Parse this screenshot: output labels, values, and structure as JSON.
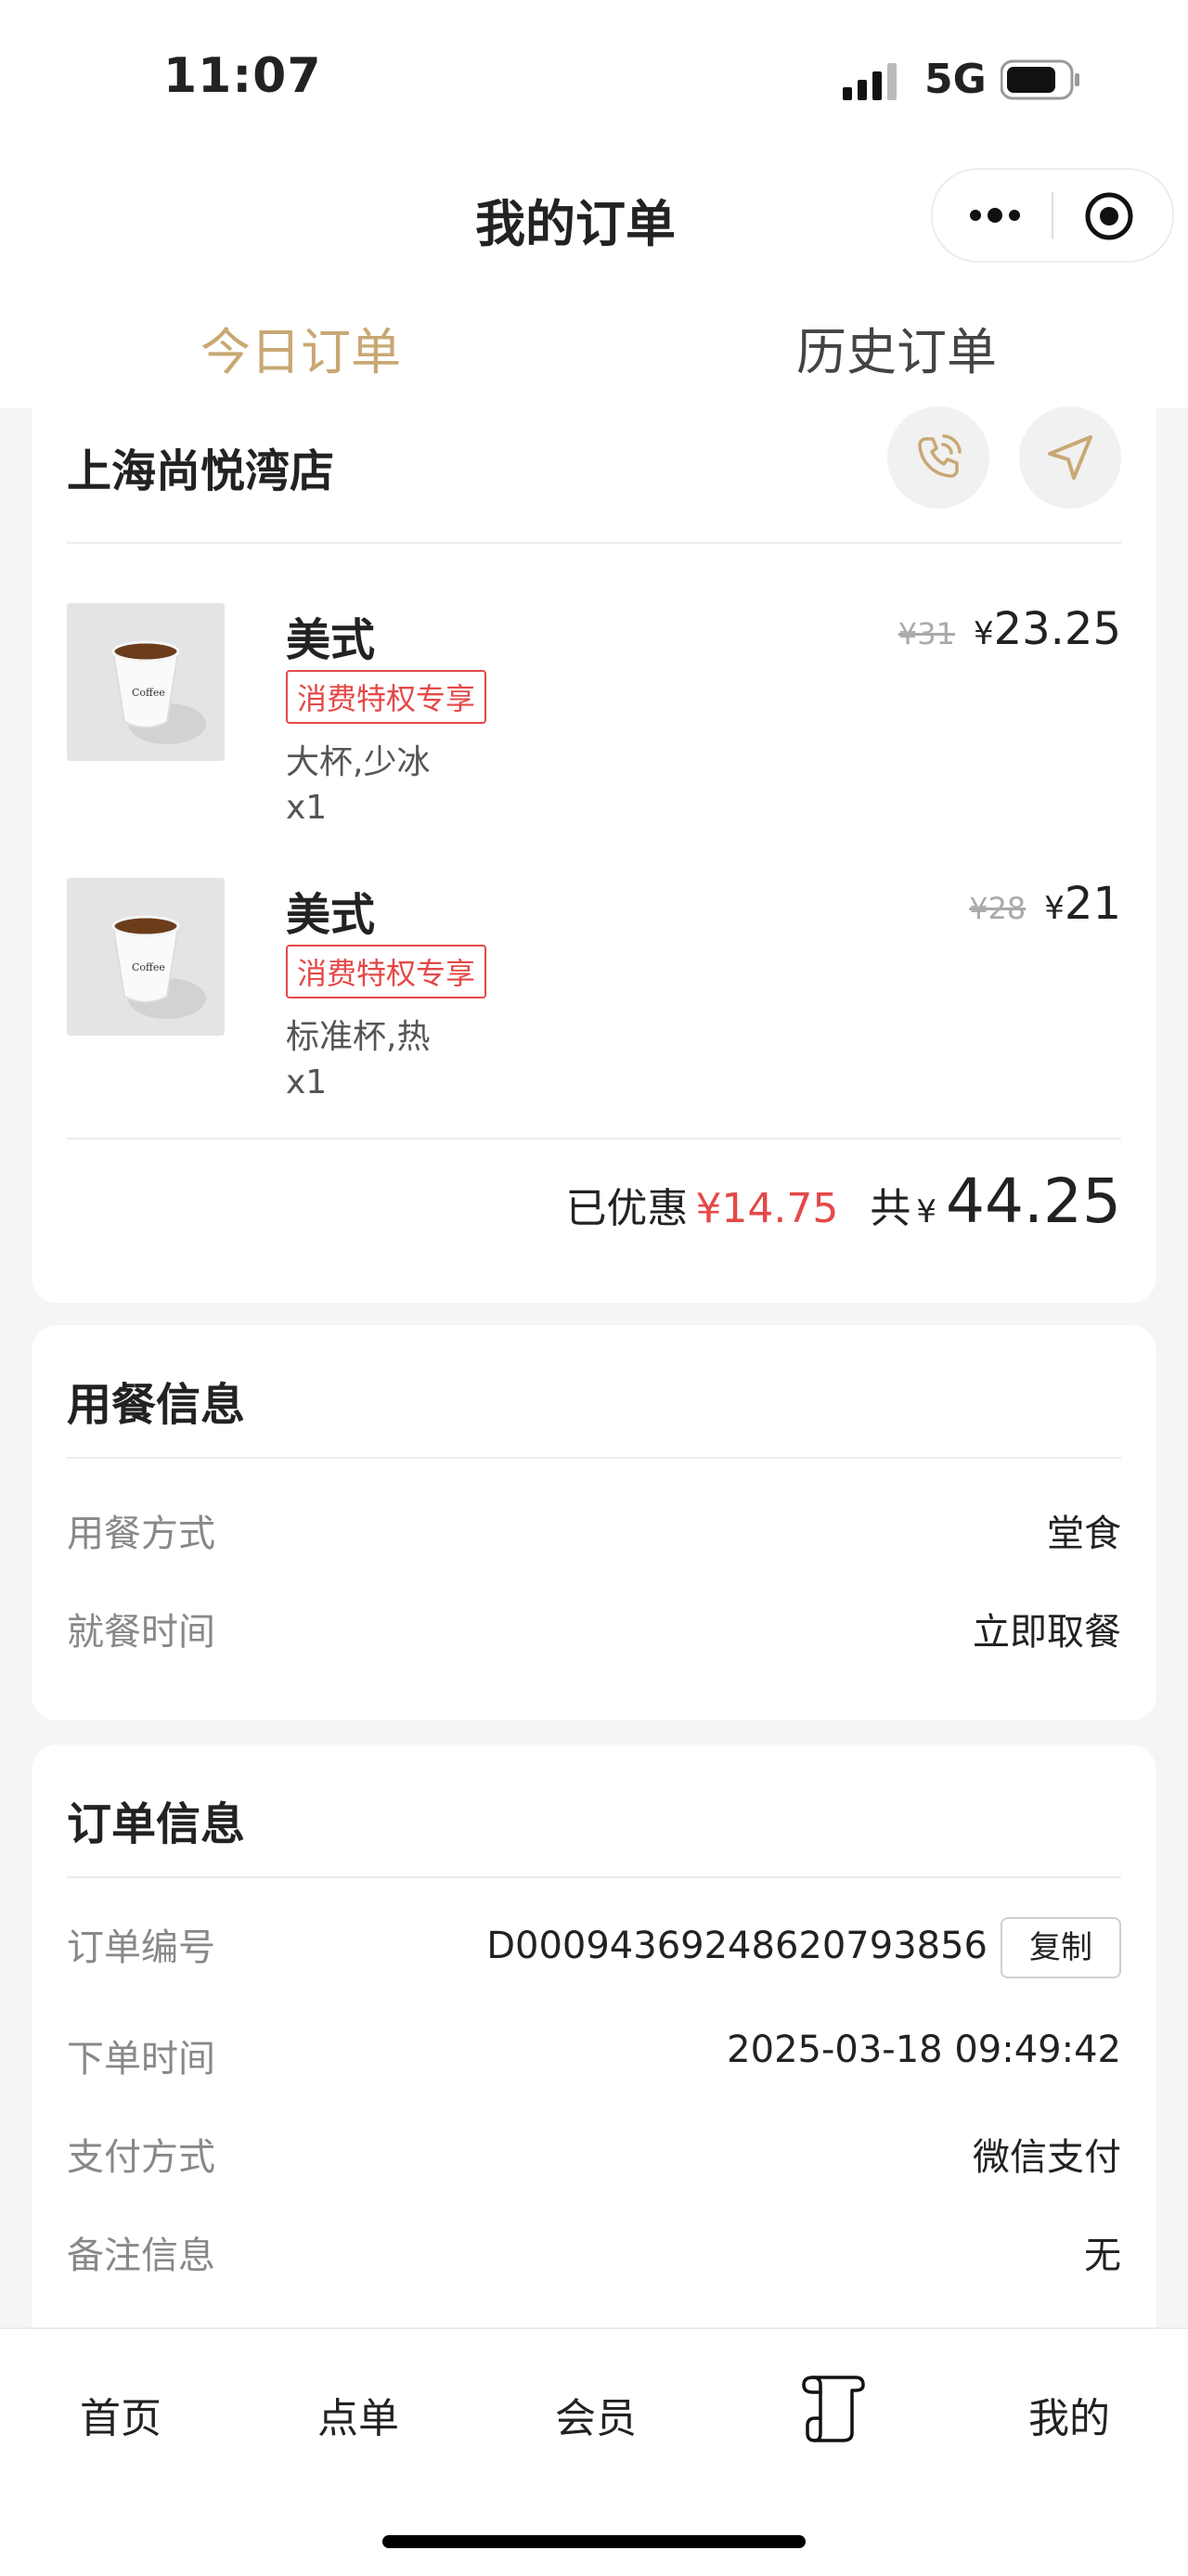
{
  "status_bar": {
    "time": "11:07",
    "network": "5G"
  },
  "header": {
    "title": "我的订单"
  },
  "tabs": [
    {
      "label": "今日订单",
      "active": true
    },
    {
      "label": "历史订单",
      "active": false
    }
  ],
  "store": {
    "name": "上海尚悦湾店",
    "items": [
      {
        "name": "美式",
        "badge": "消费特权专享",
        "spec": "大杯,少冰",
        "qty": "x1",
        "original_price": "¥31",
        "currency": "¥",
        "price": "23.25"
      },
      {
        "name": "美式",
        "badge": "消费特权专享",
        "spec": "标准杯,热",
        "qty": "x1",
        "original_price": "¥28",
        "currency": "¥",
        "price": "21"
      }
    ],
    "summary": {
      "discount_label": "已优惠",
      "discount_value": "¥14.75",
      "total_label": "共",
      "currency": "¥",
      "total": "44.25"
    }
  },
  "dining_info": {
    "title": "用餐信息",
    "rows": [
      {
        "label": "用餐方式",
        "value": "堂食"
      },
      {
        "label": "就餐时间",
        "value": "立即取餐"
      }
    ]
  },
  "order_info": {
    "title": "订单信息",
    "rows": [
      {
        "label": "订单编号",
        "value": "D00094369248620793856"
      },
      {
        "label": "下单时间",
        "value": "2025-03-18 09:49:42"
      },
      {
        "label": "支付方式",
        "value": "微信支付"
      },
      {
        "label": "备注信息",
        "value": "无"
      }
    ],
    "copy_label": "复制"
  },
  "bottom_nav": {
    "home": "首页",
    "order": "点单",
    "member": "会员",
    "mine": "我的"
  },
  "colors": {
    "accent": "#c8a874",
    "red": "#e54848",
    "background": "#f5f5f5"
  }
}
